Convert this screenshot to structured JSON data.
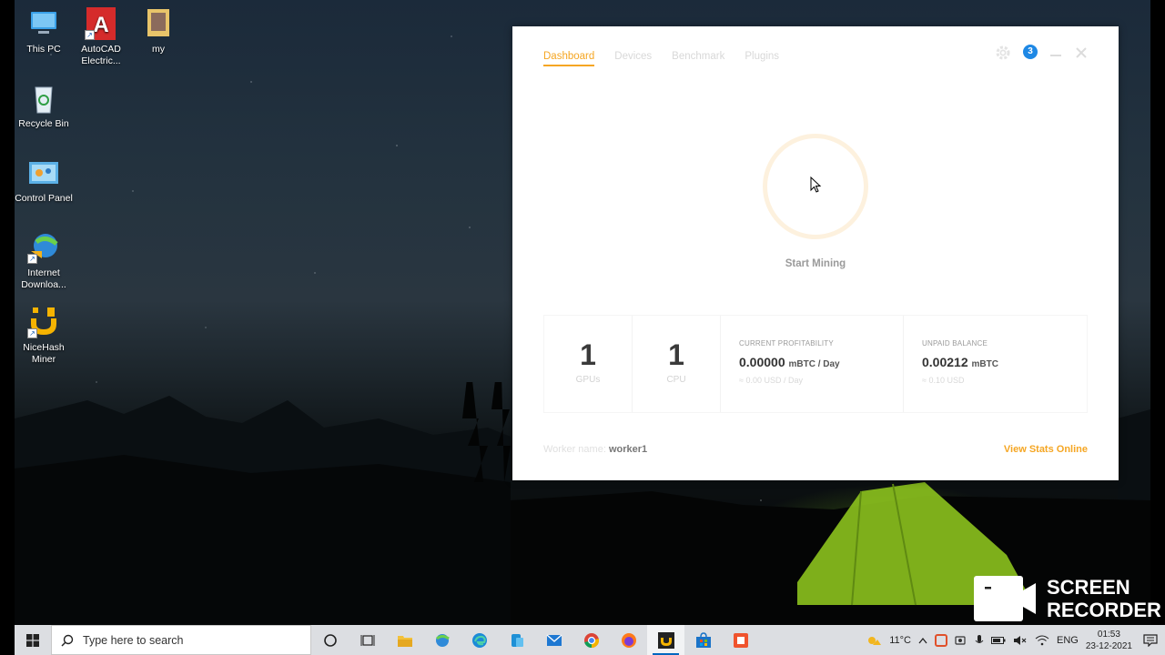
{
  "desktop": {
    "icons": [
      {
        "label": "This PC",
        "icon": "this-pc-icon"
      },
      {
        "label": "AutoCAD Electric...",
        "icon": "autocad-icon"
      },
      {
        "label": "my",
        "icon": "folder-icon"
      },
      {
        "label": "Recycle Bin",
        "icon": "recycle-bin-icon"
      },
      {
        "label": "Control Panel",
        "icon": "control-panel-icon"
      },
      {
        "label": "Internet Downloa...",
        "icon": "internet-download-manager-icon"
      },
      {
        "label": "NiceHash Miner",
        "icon": "nicehash-icon"
      }
    ]
  },
  "app": {
    "tabs": [
      "Dashboard",
      "Devices",
      "Benchmark",
      "Plugins"
    ],
    "active_tab": "Dashboard",
    "notification_count": "3",
    "start_label": "Start Mining",
    "gpus": {
      "value": "1",
      "label": "GPUs"
    },
    "cpu": {
      "value": "1",
      "label": "CPU"
    },
    "profitability": {
      "caption": "CURRENT PROFITABILITY",
      "value": "0.00000",
      "unit": "mBTC / Day",
      "sub": "≈ 0.00 USD / Day"
    },
    "balance": {
      "caption": "UNPAID BALANCE",
      "value": "0.00212",
      "unit": "mBTC",
      "sub": "≈ 0.10 USD"
    },
    "worker_label": "Worker name:",
    "worker_name": "worker1",
    "view_stats": "View Stats Online",
    "accent_color": "#f5a623"
  },
  "watermark": {
    "line1": "SCREEN",
    "line2": "RECORDER"
  },
  "taskbar": {
    "search_placeholder": "Type here to search",
    "apps": [
      "cortana-icon",
      "task-view-icon",
      "file-explorer-icon",
      "internet-download-manager-icon",
      "edge-icon",
      "phone-link-icon",
      "mail-icon",
      "chrome-icon",
      "firefox-icon",
      "nicehash-icon",
      "store-icon",
      "screen-recorder-icon"
    ],
    "temperature": "11°C",
    "language": "ENG",
    "time": "01:53",
    "date": "23-12-2021"
  }
}
